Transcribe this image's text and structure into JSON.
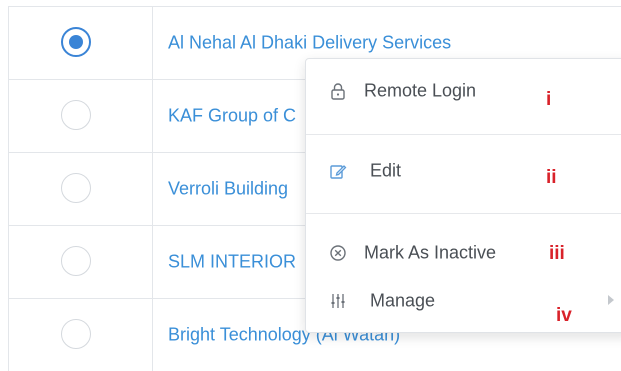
{
  "rows": [
    {
      "company": "Al Nehal Al Dhaki Delivery Services",
      "selected": true
    },
    {
      "company": "KAF Group of C",
      "selected": false
    },
    {
      "company": "Verroli Building",
      "selected": false
    },
    {
      "company": "SLM INTERIOR",
      "selected": false
    },
    {
      "company": "Bright Technology (Al Watan)",
      "selected": false
    }
  ],
  "menu": {
    "items": [
      {
        "label": "Remote Login",
        "icon": "lock-icon",
        "annotation": "i"
      },
      {
        "label": "Edit",
        "icon": "edit-icon",
        "annotation": "ii"
      },
      {
        "label": "Mark As Inactive",
        "icon": "close-circle-icon",
        "annotation": "iii"
      },
      {
        "label": "Manage",
        "icon": "sliders-icon",
        "annotation": "iv"
      }
    ]
  },
  "colors": {
    "link": "#3a8fd8",
    "radio_checked": "#3a84d6",
    "annotation": "#d9222a"
  }
}
